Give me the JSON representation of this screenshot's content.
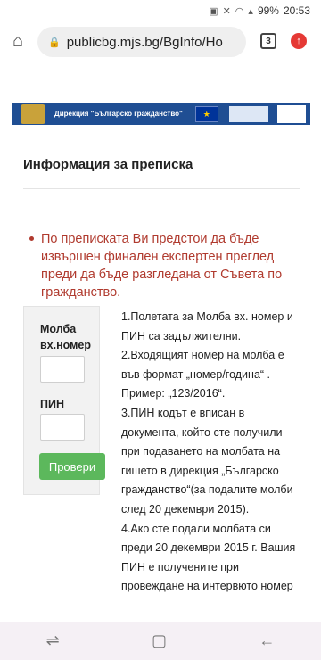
{
  "status_bar": {
    "battery": "99%",
    "time": "20:53"
  },
  "browser": {
    "url": "publicbg.mjs.bg/BgInfo/Ho",
    "tab_count": "3"
  },
  "banner": {
    "text": "Дирекция \"Българско гражданство\""
  },
  "page": {
    "title": "Информация за преписка",
    "alert": "По преписката Ви предстои да бъде извършен финален експертен преглед преди да бъде разгледана от Съвета по гражданство."
  },
  "form": {
    "label_petition": "Молба вх.номер",
    "label_pin": "ПИН",
    "petition_value": "",
    "pin_value": "",
    "submit_label": "Провери"
  },
  "info": [
    "1.Полетата за Молба вх. номер и ПИН са задължителни.",
    "2.Входящият номер на молба е във формат „номер/година“ . Пример: „123/2016“.",
    "3.ПИН кодът е вписан в документа, който сте получили при подаването на молбата на гишето в дирекция „Българско гражданство“(за подалите молби след 20 декември 2015).",
    "4.Ако сте подали молбата си преди 20 декември 2015 г. Вашия ПИН е получените при провеждане на интервюто номер"
  ],
  "colors": {
    "alert": "#b03a2e",
    "button": "#5cb85c",
    "banner": "#1f4e93"
  }
}
